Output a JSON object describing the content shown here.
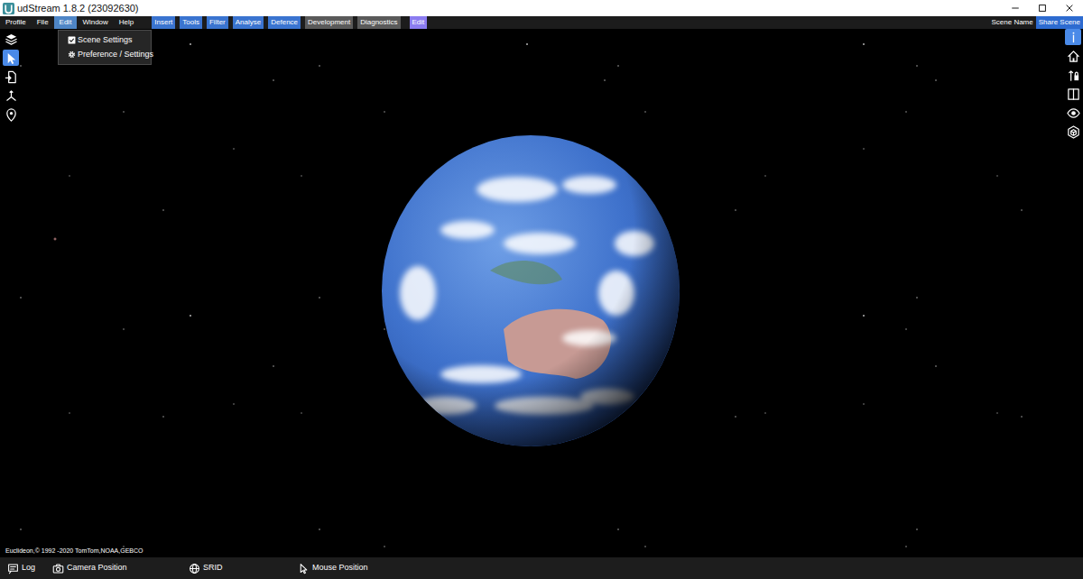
{
  "window": {
    "title": "udStream 1.8.2 (23092630)"
  },
  "menu": [
    {
      "label": "Profile",
      "selected": false
    },
    {
      "label": "File",
      "selected": false
    },
    {
      "label": "Edit",
      "selected": true
    },
    {
      "label": "Window",
      "selected": false
    },
    {
      "label": "Help",
      "selected": false
    }
  ],
  "tabs": [
    {
      "label": "Insert",
      "color": "#3a74d0"
    },
    {
      "label": "Tools",
      "color": "#3a74d0"
    },
    {
      "label": "Filter",
      "color": "#3a74d0"
    },
    {
      "label": "Analyse",
      "color": "#3a74d0"
    },
    {
      "label": "Defence",
      "color": "#3a74d0"
    },
    {
      "label": "Development",
      "color": "#5a5a5a"
    },
    {
      "label": "Diagnostics",
      "color": "#5a5a5a"
    },
    {
      "label": "Edit",
      "color": "#8b7cf0"
    }
  ],
  "header": {
    "scene_name": "Scene Name",
    "share_button": "Share Scene"
  },
  "edit_menu": [
    {
      "label": "Scene Settings"
    },
    {
      "label": "Preference / Settings"
    }
  ],
  "left_toolbar": [
    {
      "selected": false
    },
    {
      "selected": true
    },
    {
      "selected": false
    },
    {
      "selected": false
    },
    {
      "selected": false
    }
  ],
  "right_toolbar": [
    {
      "selected": true
    },
    {
      "selected": false
    },
    {
      "selected": false
    },
    {
      "selected": false
    },
    {
      "selected": false
    },
    {
      "selected": false
    }
  ],
  "attribution": "Euclideon,© 1992 -2020 TomTom,NOAA,GEBCO",
  "status_bar": [
    {
      "label": "Log"
    },
    {
      "label": "Camera Position"
    },
    {
      "label": "SRID"
    },
    {
      "label": "Mouse Position"
    }
  ]
}
